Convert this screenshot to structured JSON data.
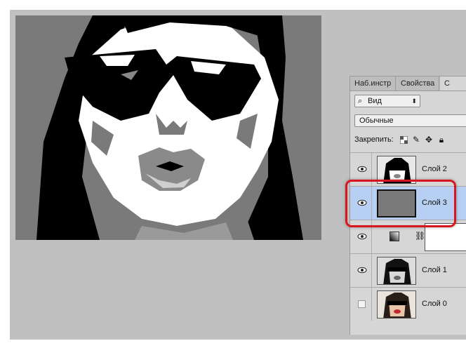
{
  "panel": {
    "tabs": [
      {
        "label": "Наб.инстр"
      },
      {
        "label": "Свойства"
      },
      {
        "label": "С"
      }
    ],
    "filter": {
      "label": "Вид",
      "icon": "search-icon"
    },
    "blend_mode": "Обычные",
    "lock_label": "Закрепить:",
    "lock_icons": [
      "lock-transparency-icon",
      "lock-brush-icon",
      "lock-move-icon",
      "lock-all-icon"
    ]
  },
  "layers": [
    {
      "name": "Слой 2",
      "visible": true,
      "selected": false
    },
    {
      "name": "Слой 3",
      "visible": true,
      "selected": true
    },
    {
      "name": "",
      "visible": true,
      "selected": false,
      "adjustment": true
    },
    {
      "name": "Слой 1",
      "visible": true,
      "selected": false
    },
    {
      "name": "Слой 0",
      "visible": false,
      "selected": false
    }
  ],
  "colors": {
    "highlight": "#d9161d",
    "selected_layer": "#b6cff2",
    "layer3_fill": "#7a7a7a"
  }
}
